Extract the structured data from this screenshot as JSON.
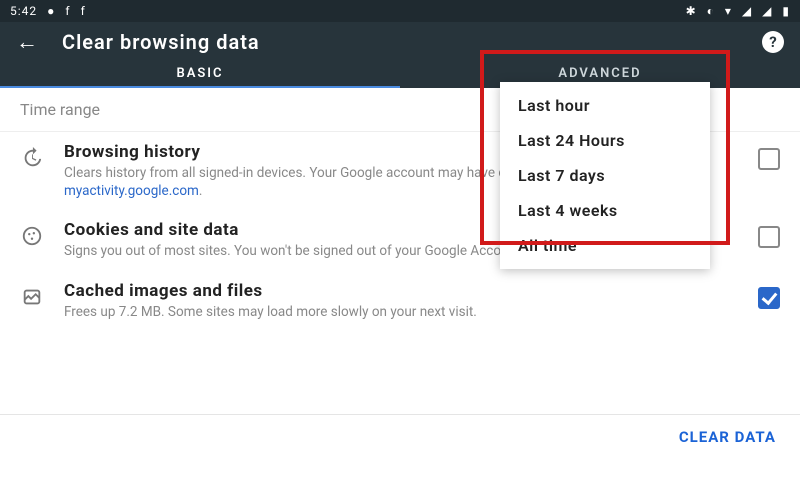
{
  "status": {
    "time": "5:42",
    "icons_left": [
      "●",
      "f",
      "f"
    ],
    "icons_right": [
      "✱",
      "◐",
      "▾",
      "◢",
      "◢",
      "▮"
    ]
  },
  "appbar": {
    "title": "Clear browsing data"
  },
  "tabs": {
    "basic": "BASIC",
    "advanced": "ADVANCED"
  },
  "timerange_label": "Time range",
  "items": {
    "history": {
      "title": "Browsing history",
      "desc_a": "Clears history from all signed-in devices. Your Google account may have other forms of browsing ",
      "link": "myactivity.google.com",
      "desc_b": "."
    },
    "cookies": {
      "title": "Cookies and site data",
      "desc": "Signs you out of most sites. You won't be signed out of your Google Account."
    },
    "cache": {
      "title": "Cached images and files",
      "desc": "Frees up 7.2 MB. Some sites may load more slowly on your next visit."
    }
  },
  "dropdown": {
    "opt0": "Last hour",
    "opt1": "Last 24 Hours",
    "opt2": "Last 7 days",
    "opt3": "Last 4 weeks",
    "opt4": "All time"
  },
  "footer": {
    "clear": "CLEAR DATA"
  }
}
